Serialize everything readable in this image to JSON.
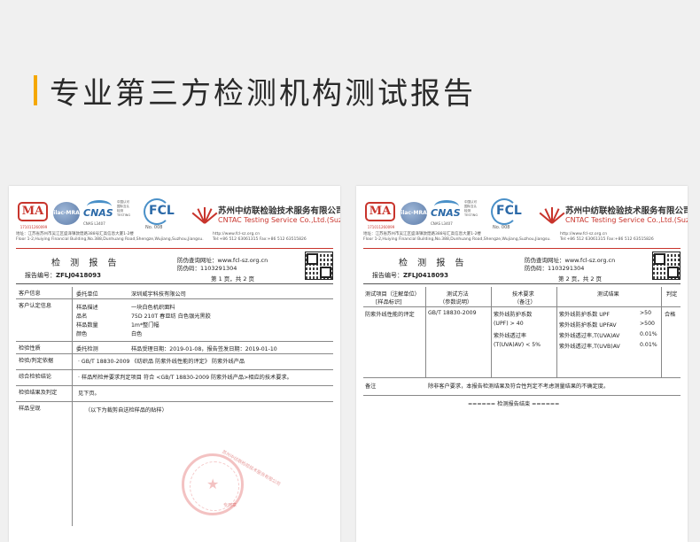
{
  "headline": "专业第三方检测机构测试报告",
  "company": {
    "cn_name": "苏州中纺联检验技术服务有限公司",
    "en_name": "CNTAC Testing Service Co.,Ltd.(Suzhou)",
    "address_cn": "地址：江苏省苏州市吴江区盛泽镇敦煌路388号汇高信息大厦1-2楼",
    "address_en": "Floor 1-2,Huiying Financial Building,No.388,Dunhuang Road,Shengze,Wujiang,Suzhou,Jiangsu.",
    "website": "http://www.fcl-sz.org.cn",
    "tel_fax": "Tel:+86 512 63061315    Fax:+86 512 63515826"
  },
  "logos": {
    "ma": "MA",
    "ma_no": "171011260099",
    "ilac": "ilac-MRA",
    "cnas": "CNAS",
    "cnas_no": "CNAS L3407",
    "cnas_side": "中国认可 国际互认 检测 TESTING",
    "fcl": "FCL",
    "fcl_no": "No. 008"
  },
  "report": {
    "title": "检 测 报 告",
    "number_label": "报告编号：",
    "number": "ZFLJ0418093",
    "site_label": "防伪查询网址：",
    "site": "www.fcl-sz.org.cn",
    "code_label": "防伪码：",
    "code": "1103291304",
    "page1": "第 1 页，共 2 页",
    "page2": "第 2 页，共 2 页"
  },
  "left_table": {
    "client_label": "客户信息",
    "client_sub": "委托单位",
    "client_value": "深圳威宇科技有限公司",
    "sample_label": "客户认定信息",
    "sample_fields": [
      {
        "k": "样品描述",
        "v": "一块白色机织面料"
      },
      {
        "k": "品名",
        "v": "75D 210T 春亚纺   白色银光黑胶"
      },
      {
        "k": "样品数量",
        "v": "1m*整门幅"
      },
      {
        "k": "颜色",
        "v": "白色"
      }
    ],
    "check_label": "检验性质",
    "check_sub": "委托检测",
    "check_dates": "样品受理日期：2019-01-08，报告签发日期：2019-01-10",
    "basis_label": "检验/判定依据",
    "basis_value": "· GB/T 18830-2009 《纺织品 防紫外线性能的评定》 防紫外线产品",
    "conclusion_label": "综合检验结论",
    "conclusion_value": "· 样品所检并要求判定项目 符合 <GB/T 18830-2009 防紫外线产品>相应的技术要求。",
    "result_label": "检验结果及判定",
    "result_value": "见下页。",
    "photo_label": "样品呈现",
    "photo_value": "（以下为裁剪自送检样品的贴样）"
  },
  "right_table": {
    "h_item": "测试项目（注解单位）",
    "h_item2": "[样品标识]",
    "h_method": "测试方法",
    "h_method2": "（参数说明）",
    "h_req": "技术要求",
    "h_req2": "（备注）",
    "h_result": "测试结果",
    "h_judge": "判定",
    "item": "防紫外线性能的评定",
    "method": "GB/T 18830-2009",
    "req": [
      "紫外线防护系数",
      "(UPF) > 40",
      "紫外线透过率",
      "(T(UVA)AV) < 5%"
    ],
    "results": [
      {
        "k": "紫外线防护系数 UPF",
        "v": ">50"
      },
      {
        "k": "紫外线防护系数 UPFAV",
        "v": ">500"
      },
      {
        "k": "紫外线透过率,T(UVA)AV",
        "v": "0.01%"
      },
      {
        "k": "紫外线透过率,T(UVB)AV",
        "v": "0.01%"
      }
    ],
    "judge": "合格",
    "note_label": "备注",
    "note_value": "除非客户要求，本报告检测结果及符合性判定不考虑测量结果的不确定度。",
    "end": "====== 检测报告结束 ======"
  },
  "seal": {
    "text": "苏州中纺联检验技术服务有限公司",
    "foot": "专用章"
  }
}
